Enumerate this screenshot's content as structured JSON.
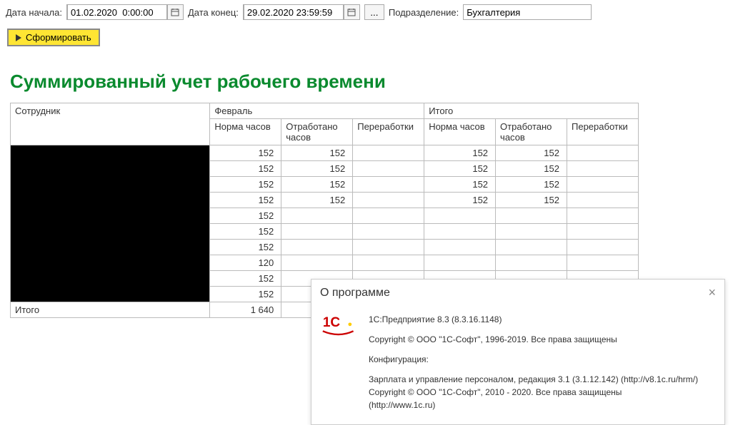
{
  "toolbar": {
    "date_start_label": "Дата начала:",
    "date_start_value": "01.02.2020  0:00:00",
    "date_end_label": "Дата конец:",
    "date_end_value": "29.02.2020 23:59:59",
    "dots": "...",
    "dept_label": "Подразделение:",
    "dept_value": "Бухгалтерия"
  },
  "form_btn": "Сформировать",
  "report": {
    "title": "Суммированный учет рабочего времени",
    "col_employee": "Сотрудник",
    "month": "Февраль",
    "total": "Итого",
    "sub_norm": "Норма часов",
    "sub_worked": "Отработано часов",
    "sub_over": "Переработки",
    "rows": [
      {
        "n": "152",
        "w": "152",
        "tn": "152",
        "tw": "152"
      },
      {
        "n": "152",
        "w": "152",
        "tn": "152",
        "tw": "152"
      },
      {
        "n": "152",
        "w": "152",
        "tn": "152",
        "tw": "152"
      },
      {
        "n": "152",
        "w": "152",
        "tn": "152",
        "tw": "152"
      },
      {
        "n": "152",
        "w": "",
        "tn": "",
        "tw": ""
      },
      {
        "n": "152",
        "w": "",
        "tn": "",
        "tw": ""
      },
      {
        "n": "152",
        "w": "",
        "tn": "",
        "tw": ""
      },
      {
        "n": "120",
        "w": "",
        "tn": "",
        "tw": ""
      },
      {
        "n": "152",
        "w": "",
        "tn": "",
        "tw": ""
      },
      {
        "n": "152",
        "w": "",
        "tn": "",
        "tw": ""
      }
    ],
    "footer_label": "Итого",
    "footer_norm": "1 640"
  },
  "dialog": {
    "title": "О программе",
    "line1": "1С:Предприятие 8.3 (8.3.16.1148)",
    "line2": "Copyright © ООО \"1С-Софт\", 1996-2019. Все права защищены",
    "conf_label": "Конфигурация:",
    "conf1": "Зарплата и управление персоналом, редакция 3.1 (3.1.12.142) (http://v8.1c.ru/hrm/)",
    "conf2": "Copyright © ООО \"1С-Софт\", 2010 - 2020. Все права защищены",
    "conf3": "(http://www.1c.ru)"
  }
}
